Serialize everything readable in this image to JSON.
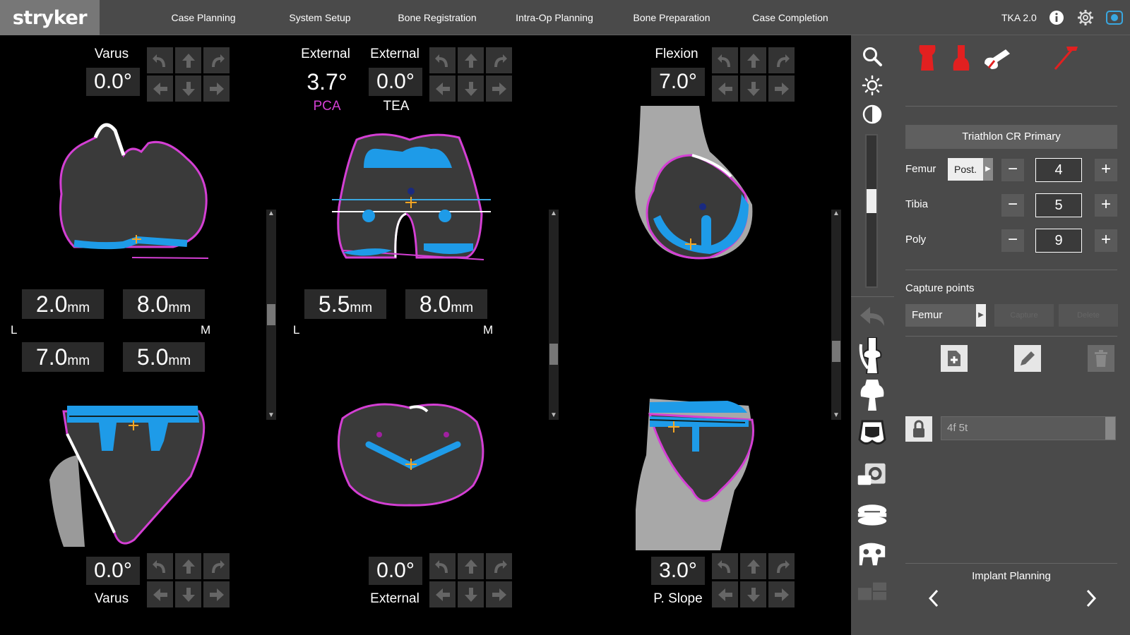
{
  "brand": "stryker",
  "nav": {
    "tabs": [
      "Case Planning",
      "System Setup",
      "Bone Registration",
      "Intra-Op Planning",
      "Bone Preparation",
      "Case Completion"
    ],
    "version": "TKA 2.0"
  },
  "left_panel": {
    "top_label": "Varus",
    "top_value": "0.0°",
    "mm": [
      "2.0",
      "8.0",
      "7.0",
      "5.0"
    ],
    "unit": "mm",
    "side_l": "L",
    "side_m": "M",
    "bottom_value": "0.0°",
    "bottom_label": "Varus"
  },
  "middle_panel": {
    "pca_label": "External",
    "pca_value": "3.7°",
    "pca_caption": "PCA",
    "tea_label": "External",
    "tea_value": "0.0°",
    "tea_caption": "TEA",
    "mm": [
      "5.5",
      "8.0"
    ],
    "unit": "mm",
    "side_l": "L",
    "side_m": "M",
    "bottom_value": "0.0°",
    "bottom_label": "External"
  },
  "right_view": {
    "top_label": "Flexion",
    "top_value": "7.0°",
    "bottom_value": "3.0°",
    "bottom_label": "P. Slope"
  },
  "planning": {
    "product": "Triathlon CR Primary",
    "femur_label": "Femur",
    "femur_option": "Post.",
    "femur_size": "4",
    "tibia_label": "Tibia",
    "tibia_size": "5",
    "poly_label": "Poly",
    "poly_size": "9",
    "capture_title": "Capture points",
    "capture_select": "Femur",
    "capture_button": "Capture",
    "delete_button": "Delete",
    "note_value": "4f 5t",
    "footer_title": "Implant Planning"
  },
  "colors": {
    "implant": "#1e9be8",
    "contour": "#d43fd4",
    "red_tool": "#e22020",
    "topbar": "#4a4a4a"
  },
  "icons": {
    "tools": [
      "zoom-icon",
      "brightness-icon",
      "contrast-icon",
      "undo-icon",
      "knee-joint-icon",
      "femur-implant-icon",
      "tibia-implant-icon",
      "ct-view-icon",
      "poly-insert-icon",
      "tibial-tray-icon",
      "layout-icon"
    ],
    "header": [
      "info-icon",
      "gear-icon",
      "camera-icon"
    ]
  }
}
